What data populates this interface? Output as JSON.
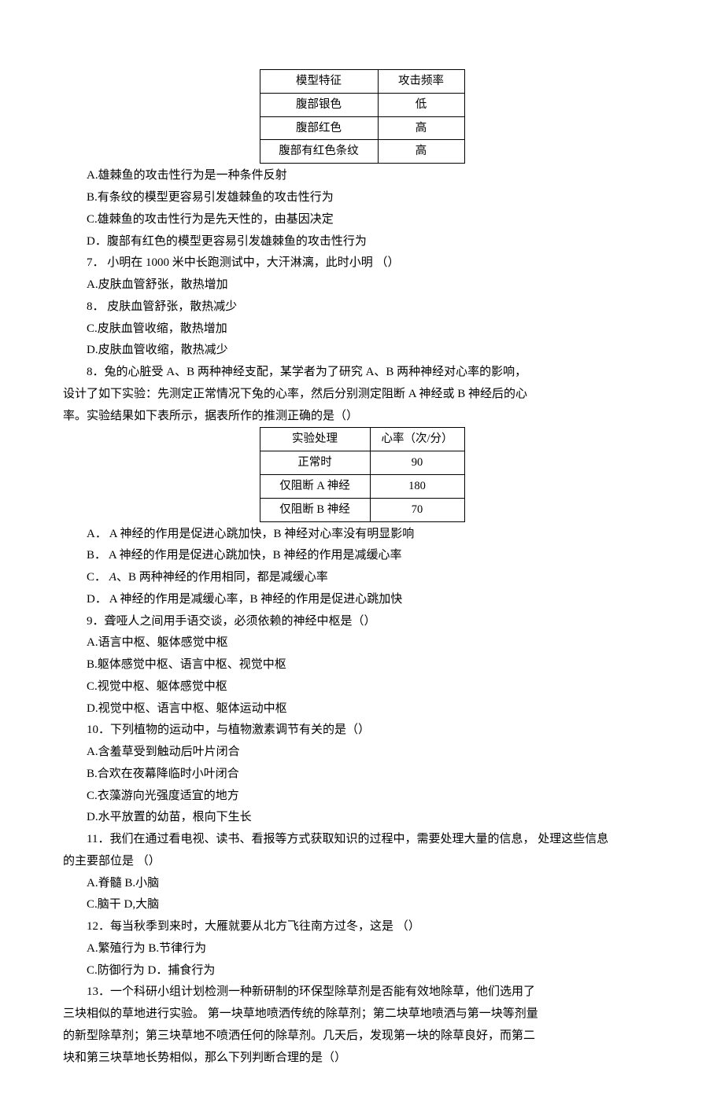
{
  "table1": {
    "headers": [
      "模型特征",
      "攻击频率"
    ],
    "rows": [
      [
        "腹部银色",
        "低"
      ],
      [
        "腹部红色",
        "高"
      ],
      [
        "腹部有红色条纹",
        "高"
      ]
    ]
  },
  "q6": {
    "opt_a": "A.雄棘鱼的攻击性行为是一种条件反射",
    "opt_b": "B.有条纹的模型更容易引发雄棘鱼的攻击性行为",
    "opt_c": "C.雄棘鱼的攻击性行为是先天性的，由基因决定",
    "opt_d": "D．腹部有红色的模型更容易引发雄棘鱼的攻击性行为"
  },
  "q7": {
    "stem": "7．  小明在 1000 米中长跑测试中，大汗淋漓，此时小明  （）",
    "opt_a": "A.皮肤血管舒张，散热增加",
    "opt_b": "8．  皮肤血管舒张，散热减少",
    "opt_c": "C.皮肤血管收缩，散热增加",
    "opt_d": "D.皮肤血管收缩，散热减少"
  },
  "q8": {
    "stem1": "8．兔的心脏受 A、B 两种神经支配，某学者为了研究 A、B 两种神经对心率的影响，",
    "stem2": "设计了如下实验：先测定正常情况下兔的心率，然后分别测定阻断 A 神经或 B 神经后的心",
    "stem3": "率。实验结果如下表所示，据表所作的推测正确的是（）",
    "opt_a": "A．  A 神经的作用是促进心跳加快，B 神经对心率没有明显影响",
    "opt_b": "B．  A 神经的作用是促进心跳加快，B 神经的作用是减缓心率",
    "opt_c_pre": "C．  ",
    "opt_c_em": "A",
    "opt_c_post": "、B 两种神经的作用相同，都是减缓心率",
    "opt_d": "D．  A 神经的作用是减缓心率，B 神经的作用是促进心跳加快"
  },
  "table2": {
    "headers": [
      "实验处理",
      "心率（次/分）"
    ],
    "rows": [
      [
        "正常时",
        "90"
      ],
      [
        "仅阻断 A 神经",
        "180"
      ],
      [
        "仅阻断 B 神经",
        "70"
      ]
    ]
  },
  "q9": {
    "stem": "9．聋哑人之间用手语交谈，必须依赖的神经中枢是（）",
    "opt_a": "A.语言中枢、躯体感觉中枢",
    "opt_b": "B.躯体感觉中枢、语言中枢、视觉中枢",
    "opt_c": "C.视觉中枢、躯体感觉中枢",
    "opt_d": "D.视觉中枢、语言中枢、躯体运动中枢"
  },
  "q10": {
    "stem": "10．下列植物的运动中，与植物激素调节有关的是（）",
    "opt_a": "A.含羞草受到触动后叶片闭合",
    "opt_b": "B.合欢在夜幕降临时小叶闭合",
    "opt_c": "C.衣藻游向光强度适宜的地方",
    "opt_d": "D.水平放置的幼苗，根向下生长"
  },
  "q11": {
    "stem1": "11．我们在通过看电视、读书、看报等方式获取知识的过程中，需要处理大量的信息， 处理这些信息",
    "stem2": "的主要部位是  （）",
    "opt_ab": "A.脊髓 B.小脑",
    "opt_cd": "C.脑干 D,大脑"
  },
  "q12": {
    "stem": "12．每当秋季到来时，大雁就要从北方飞往南方过冬，这是  （）",
    "opt_ab": "A.繁殖行为 B.节律行为",
    "opt_cd": "C.防御行为 D．捕食行为"
  },
  "q13": {
    "stem1": "13．一个科研小组计划检测一种新研制的环保型除草剂是否能有效地除草，他们选用了",
    "stem2": "三块相似的草地进行实验。 第一块草地喷洒传统的除草剂；第二块草地喷洒与第一块等剂量",
    "stem3": "的新型除草剂；第三块草地不喷洒任何的除草剂。几天后，发现第一块的除草良好，而第二",
    "stem4": "块和第三块草地长势相似，那么下列判断合理的是（）"
  }
}
